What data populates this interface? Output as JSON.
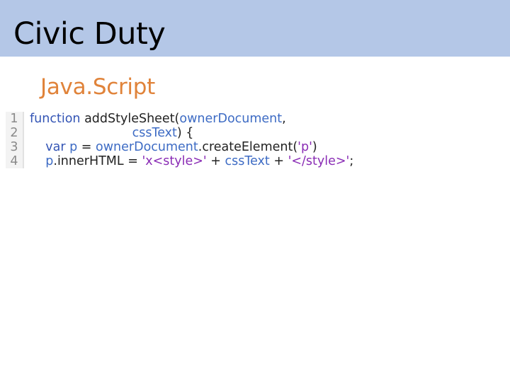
{
  "slide": {
    "title": "Civic Duty",
    "subtitle": "Java.Script"
  },
  "code": {
    "line_numbers": [
      "1",
      "2",
      "3",
      "4"
    ],
    "lines": [
      {
        "indent": "",
        "tokens": [
          {
            "text": "function",
            "kind": "kw"
          },
          {
            "text": " addStyleSheet(",
            "kind": "fn"
          },
          {
            "text": "ownerDocument",
            "kind": "id"
          },
          {
            "text": ",",
            "kind": "pl"
          }
        ]
      },
      {
        "indent": "                          ",
        "tokens": [
          {
            "text": "cssText",
            "kind": "id"
          },
          {
            "text": ") {",
            "kind": "pl"
          }
        ]
      },
      {
        "indent": "    ",
        "tokens": [
          {
            "text": "var",
            "kind": "kw"
          },
          {
            "text": " ",
            "kind": "pl"
          },
          {
            "text": "p",
            "kind": "id"
          },
          {
            "text": " = ",
            "kind": "pl"
          },
          {
            "text": "ownerDocument",
            "kind": "id"
          },
          {
            "text": ".createElement(",
            "kind": "pl"
          },
          {
            "text": "'p'",
            "kind": "str"
          },
          {
            "text": ")",
            "kind": "pl"
          }
        ]
      },
      {
        "indent": "    ",
        "tokens": [
          {
            "text": "p",
            "kind": "id"
          },
          {
            "text": ".innerHTML = ",
            "kind": "pl"
          },
          {
            "text": "'x<style>'",
            "kind": "str"
          },
          {
            "text": " + ",
            "kind": "pl"
          },
          {
            "text": "cssText",
            "kind": "id"
          },
          {
            "text": " + ",
            "kind": "pl"
          },
          {
            "text": "'</style>'",
            "kind": "str"
          },
          {
            "text": ";",
            "kind": "pl"
          }
        ]
      }
    ]
  },
  "colors": {
    "title_bar": "#b4c7e7",
    "subtitle": "#e0833a",
    "keyword": "#3455b5",
    "identifier": "#3d6bc4",
    "string": "#8a2db5"
  }
}
